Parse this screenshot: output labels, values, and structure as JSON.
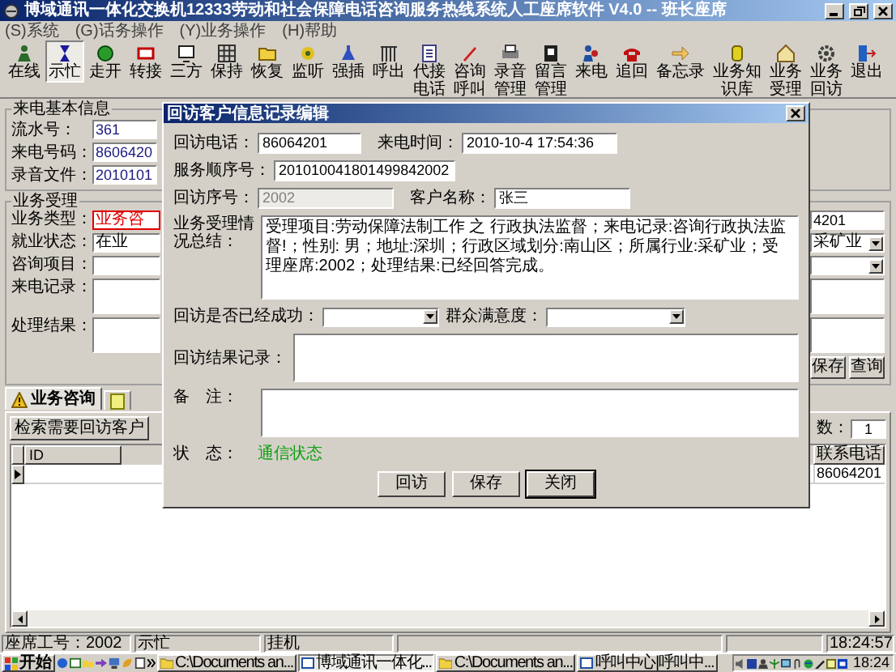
{
  "window": {
    "title": "博域通讯一体化交换机12333劳动和社会保障电话咨询服务热线系统人工座席软件 V4.0 -- 班长座席"
  },
  "menu": [
    "(S)系统",
    "(G)话务操作",
    "(Y)业务操作",
    "(H)帮助"
  ],
  "toolbar": [
    {
      "label": "在线",
      "selected": false
    },
    {
      "label": "示忙",
      "selected": true
    },
    {
      "label": "走开",
      "selected": false
    },
    {
      "label": "转接",
      "selected": false
    },
    {
      "label": "三方",
      "selected": false
    },
    {
      "label": "保持",
      "selected": false
    },
    {
      "label": "恢复",
      "selected": false
    },
    {
      "label": "监听",
      "selected": false
    },
    {
      "label": "强插",
      "selected": false
    },
    {
      "label": "呼出",
      "selected": false
    },
    {
      "label": "代接电话",
      "selected": false
    },
    {
      "label": "咨询呼叫",
      "selected": false
    },
    {
      "label": "录音管理",
      "selected": false
    },
    {
      "label": "留言管理",
      "selected": false
    },
    {
      "label": "来电",
      "selected": false
    },
    {
      "label": "追回",
      "selected": false
    },
    {
      "label": "备忘录",
      "selected": false
    },
    {
      "label": "业务知识库",
      "selected": false
    },
    {
      "label": "业务受理",
      "selected": false
    },
    {
      "label": "业务回访",
      "selected": false
    },
    {
      "label": "退出",
      "selected": false
    }
  ],
  "caller_info": {
    "title": "来电基本信息",
    "fields": [
      {
        "label": "流水号：",
        "value": "361"
      },
      {
        "label": "来电号码：",
        "value": "8606420"
      },
      {
        "label": "录音文件：",
        "value": "2010101"
      }
    ]
  },
  "business": {
    "title": "业务受理",
    "left": [
      {
        "kind": "input",
        "label": "业务类型：",
        "value": "业务咨",
        "highlighted": true
      },
      {
        "kind": "input",
        "label": "就业状态：",
        "value": "在业",
        "highlighted": false
      },
      {
        "kind": "input",
        "label": "咨询项目：",
        "highlighted": false
      },
      {
        "kind": "textarea",
        "label": "来电记录：",
        "highlighted": false
      },
      {
        "kind": "textarea",
        "label": "处理结果：",
        "highlighted": false
      }
    ],
    "right": [
      {
        "kind": "input",
        "value": "4201"
      },
      {
        "kind": "select",
        "value": "采矿业"
      },
      {
        "kind": "select"
      },
      {
        "kind": "textarea"
      },
      {
        "kind": "textarea"
      }
    ],
    "buttons": [
      "保存",
      "查询"
    ]
  },
  "tabs": [
    {
      "label": "业务咨询",
      "selected": true
    },
    {
      "selected": false
    }
  ],
  "search_button": "检索需要回访客户",
  "count": {
    "label": "数：",
    "value": "1"
  },
  "grid": {
    "columns": [
      "ID",
      "联系电话"
    ],
    "rows": [
      {
        "phone": "86064201",
        "selected": true
      }
    ]
  },
  "dialog": {
    "title": "回访客户信息记录编辑",
    "fields": [
      {
        "label": "回访电话：",
        "value": "86064201",
        "disabled": false
      },
      {
        "label": "来电时间：",
        "value": "2010-10-4 17:54:36",
        "disabled": false
      },
      {
        "label": "服务顺序号：",
        "value": "201010041801499842002",
        "disabled": false
      },
      {
        "label": "回访序号：",
        "value": "2002",
        "disabled": true
      },
      {
        "label": "客户名称：",
        "value": "张三",
        "disabled": false
      }
    ],
    "summary": {
      "label": "业务受理情况总结：",
      "value": "受理项目:劳动保障法制工作 之 行政执法监督；来电记录:咨询行政执法监督!；性别: 男；地址:深圳；行政区域划分:南山区；所属行业:采矿业；受理座席:2002；处理结果:已经回答完成。"
    },
    "selects": [
      {
        "label": "回访是否已经成功："
      },
      {
        "label": "群众满意度："
      }
    ],
    "result": {
      "label": "回访结果记录："
    },
    "note": {
      "label": "备　注："
    },
    "status": {
      "label": "状　态：",
      "value": "通信状态"
    },
    "buttons": [
      {
        "label": "回访",
        "default": false
      },
      {
        "label": "保存",
        "default": false
      },
      {
        "label": "关闭",
        "default": true
      }
    ]
  },
  "status_bar": {
    "agent": "座席工号：2002",
    "state": "示忙",
    "line": "挂机",
    "time": "18:24:57"
  },
  "taskbar": {
    "start": "开始",
    "tasks": [
      {
        "label": "C:\\Documents an...",
        "selected": false
      },
      {
        "label": "博域通讯一体化...",
        "selected": true
      },
      {
        "label": "C:\\Documents an...",
        "selected": false
      },
      {
        "label": "呼叫中心|呼叫中...",
        "selected": false
      }
    ],
    "clock": "18:24"
  }
}
